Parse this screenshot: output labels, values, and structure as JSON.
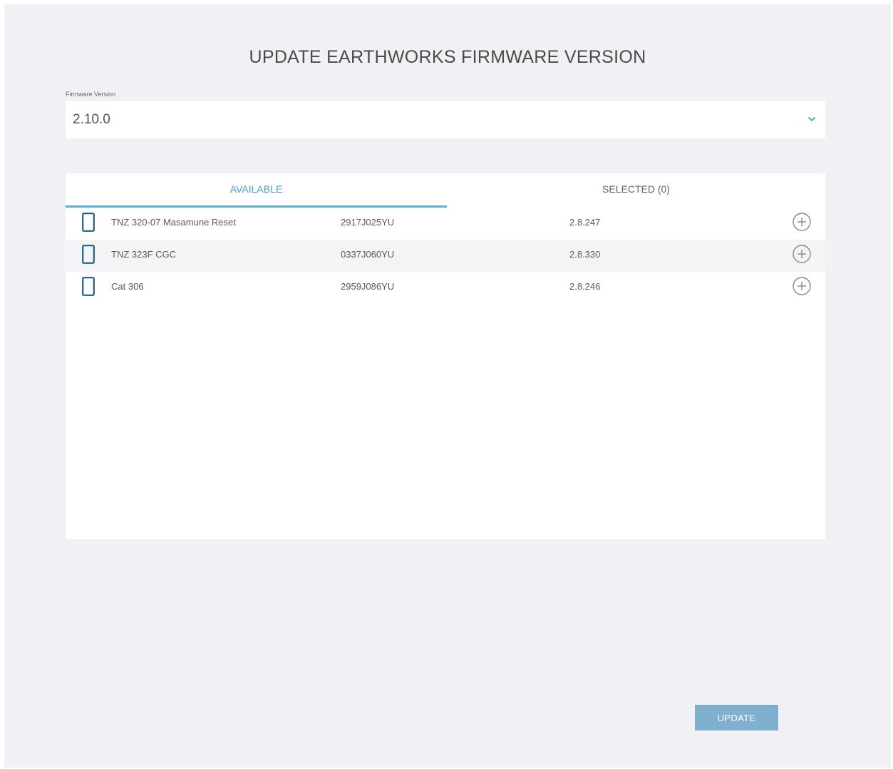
{
  "dialog": {
    "title": "UPDATE EARTHWORKS FIRMWARE VERSION"
  },
  "firmware": {
    "label": "Firmware Version",
    "selected_value": "2.10.0"
  },
  "tabs": [
    {
      "label": "AVAILABLE",
      "active": true
    },
    {
      "label": "SELECTED (0)",
      "active": false
    }
  ],
  "devices": [
    {
      "name": "TNZ 320-07 Masamune Reset",
      "serial": "2917J025YU",
      "version": "2.8.247"
    },
    {
      "name": "TNZ 323F CGC",
      "serial": "0337J060YU",
      "version": "2.8.330"
    },
    {
      "name": "Cat 306",
      "serial": "2959J086YU",
      "version": "2.8.246"
    }
  ],
  "actions": {
    "update_label": "UPDATE"
  },
  "colors": {
    "accent": "#3fa0c8",
    "button": "#7fb0d0",
    "device_icon": "#1f5f86",
    "background": "#f0f0f5"
  },
  "icons": {
    "dropdown": "chevron-down-icon",
    "device": "device-tablet-icon",
    "add": "plus-circle-icon"
  }
}
